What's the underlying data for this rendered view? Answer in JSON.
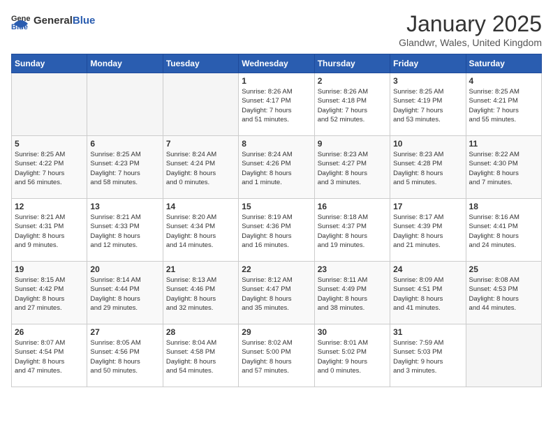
{
  "header": {
    "logo_general": "General",
    "logo_blue": "Blue",
    "title": "January 2025",
    "subtitle": "Glandwr, Wales, United Kingdom"
  },
  "weekdays": [
    "Sunday",
    "Monday",
    "Tuesday",
    "Wednesday",
    "Thursday",
    "Friday",
    "Saturday"
  ],
  "weeks": [
    [
      {
        "day": "",
        "info": ""
      },
      {
        "day": "",
        "info": ""
      },
      {
        "day": "",
        "info": ""
      },
      {
        "day": "1",
        "info": "Sunrise: 8:26 AM\nSunset: 4:17 PM\nDaylight: 7 hours\nand 51 minutes."
      },
      {
        "day": "2",
        "info": "Sunrise: 8:26 AM\nSunset: 4:18 PM\nDaylight: 7 hours\nand 52 minutes."
      },
      {
        "day": "3",
        "info": "Sunrise: 8:25 AM\nSunset: 4:19 PM\nDaylight: 7 hours\nand 53 minutes."
      },
      {
        "day": "4",
        "info": "Sunrise: 8:25 AM\nSunset: 4:21 PM\nDaylight: 7 hours\nand 55 minutes."
      }
    ],
    [
      {
        "day": "5",
        "info": "Sunrise: 8:25 AM\nSunset: 4:22 PM\nDaylight: 7 hours\nand 56 minutes."
      },
      {
        "day": "6",
        "info": "Sunrise: 8:25 AM\nSunset: 4:23 PM\nDaylight: 7 hours\nand 58 minutes."
      },
      {
        "day": "7",
        "info": "Sunrise: 8:24 AM\nSunset: 4:24 PM\nDaylight: 8 hours\nand 0 minutes."
      },
      {
        "day": "8",
        "info": "Sunrise: 8:24 AM\nSunset: 4:26 PM\nDaylight: 8 hours\nand 1 minute."
      },
      {
        "day": "9",
        "info": "Sunrise: 8:23 AM\nSunset: 4:27 PM\nDaylight: 8 hours\nand 3 minutes."
      },
      {
        "day": "10",
        "info": "Sunrise: 8:23 AM\nSunset: 4:28 PM\nDaylight: 8 hours\nand 5 minutes."
      },
      {
        "day": "11",
        "info": "Sunrise: 8:22 AM\nSunset: 4:30 PM\nDaylight: 8 hours\nand 7 minutes."
      }
    ],
    [
      {
        "day": "12",
        "info": "Sunrise: 8:21 AM\nSunset: 4:31 PM\nDaylight: 8 hours\nand 9 minutes."
      },
      {
        "day": "13",
        "info": "Sunrise: 8:21 AM\nSunset: 4:33 PM\nDaylight: 8 hours\nand 12 minutes."
      },
      {
        "day": "14",
        "info": "Sunrise: 8:20 AM\nSunset: 4:34 PM\nDaylight: 8 hours\nand 14 minutes."
      },
      {
        "day": "15",
        "info": "Sunrise: 8:19 AM\nSunset: 4:36 PM\nDaylight: 8 hours\nand 16 minutes."
      },
      {
        "day": "16",
        "info": "Sunrise: 8:18 AM\nSunset: 4:37 PM\nDaylight: 8 hours\nand 19 minutes."
      },
      {
        "day": "17",
        "info": "Sunrise: 8:17 AM\nSunset: 4:39 PM\nDaylight: 8 hours\nand 21 minutes."
      },
      {
        "day": "18",
        "info": "Sunrise: 8:16 AM\nSunset: 4:41 PM\nDaylight: 8 hours\nand 24 minutes."
      }
    ],
    [
      {
        "day": "19",
        "info": "Sunrise: 8:15 AM\nSunset: 4:42 PM\nDaylight: 8 hours\nand 27 minutes."
      },
      {
        "day": "20",
        "info": "Sunrise: 8:14 AM\nSunset: 4:44 PM\nDaylight: 8 hours\nand 29 minutes."
      },
      {
        "day": "21",
        "info": "Sunrise: 8:13 AM\nSunset: 4:46 PM\nDaylight: 8 hours\nand 32 minutes."
      },
      {
        "day": "22",
        "info": "Sunrise: 8:12 AM\nSunset: 4:47 PM\nDaylight: 8 hours\nand 35 minutes."
      },
      {
        "day": "23",
        "info": "Sunrise: 8:11 AM\nSunset: 4:49 PM\nDaylight: 8 hours\nand 38 minutes."
      },
      {
        "day": "24",
        "info": "Sunrise: 8:09 AM\nSunset: 4:51 PM\nDaylight: 8 hours\nand 41 minutes."
      },
      {
        "day": "25",
        "info": "Sunrise: 8:08 AM\nSunset: 4:53 PM\nDaylight: 8 hours\nand 44 minutes."
      }
    ],
    [
      {
        "day": "26",
        "info": "Sunrise: 8:07 AM\nSunset: 4:54 PM\nDaylight: 8 hours\nand 47 minutes."
      },
      {
        "day": "27",
        "info": "Sunrise: 8:05 AM\nSunset: 4:56 PM\nDaylight: 8 hours\nand 50 minutes."
      },
      {
        "day": "28",
        "info": "Sunrise: 8:04 AM\nSunset: 4:58 PM\nDaylight: 8 hours\nand 54 minutes."
      },
      {
        "day": "29",
        "info": "Sunrise: 8:02 AM\nSunset: 5:00 PM\nDaylight: 8 hours\nand 57 minutes."
      },
      {
        "day": "30",
        "info": "Sunrise: 8:01 AM\nSunset: 5:02 PM\nDaylight: 9 hours\nand 0 minutes."
      },
      {
        "day": "31",
        "info": "Sunrise: 7:59 AM\nSunset: 5:03 PM\nDaylight: 9 hours\nand 3 minutes."
      },
      {
        "day": "",
        "info": ""
      }
    ]
  ]
}
